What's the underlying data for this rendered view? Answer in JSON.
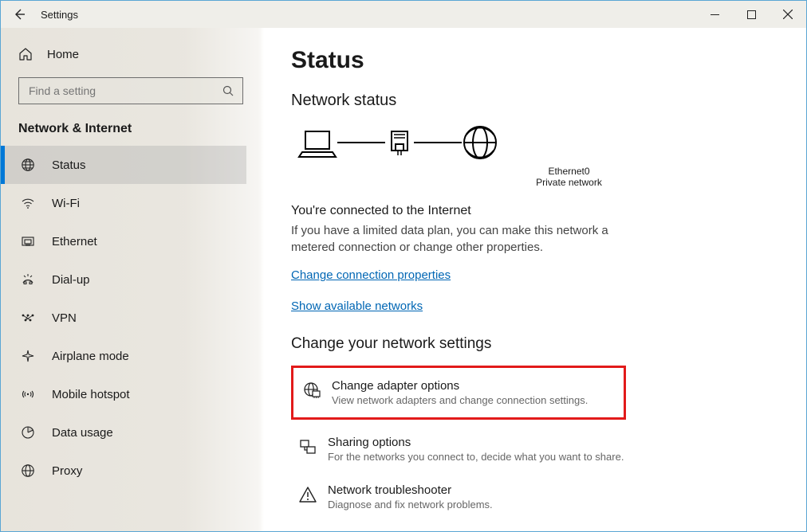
{
  "titlebar": {
    "title": "Settings"
  },
  "sidebar": {
    "home_label": "Home",
    "search_placeholder": "Find a setting",
    "section_title": "Network & Internet",
    "items": [
      {
        "label": "Status"
      },
      {
        "label": "Wi-Fi"
      },
      {
        "label": "Ethernet"
      },
      {
        "label": "Dial-up"
      },
      {
        "label": "VPN"
      },
      {
        "label": "Airplane mode"
      },
      {
        "label": "Mobile hotspot"
      },
      {
        "label": "Data usage"
      },
      {
        "label": "Proxy"
      }
    ]
  },
  "main": {
    "heading": "Status",
    "subheading": "Network status",
    "diagram": {
      "adapter_name": "Ethernet0",
      "network_type": "Private network"
    },
    "connected_heading": "You're connected to the Internet",
    "connected_desc": "If you have a limited data plan, you can make this network a metered connection or change other properties.",
    "link_change_props": "Change connection properties",
    "link_show_networks": "Show available networks",
    "change_settings_heading": "Change your network settings",
    "settings": [
      {
        "title": "Change adapter options",
        "desc": "View network adapters and change connection settings."
      },
      {
        "title": "Sharing options",
        "desc": "For the networks you connect to, decide what you want to share."
      },
      {
        "title": "Network troubleshooter",
        "desc": "Diagnose and fix network problems."
      }
    ]
  }
}
